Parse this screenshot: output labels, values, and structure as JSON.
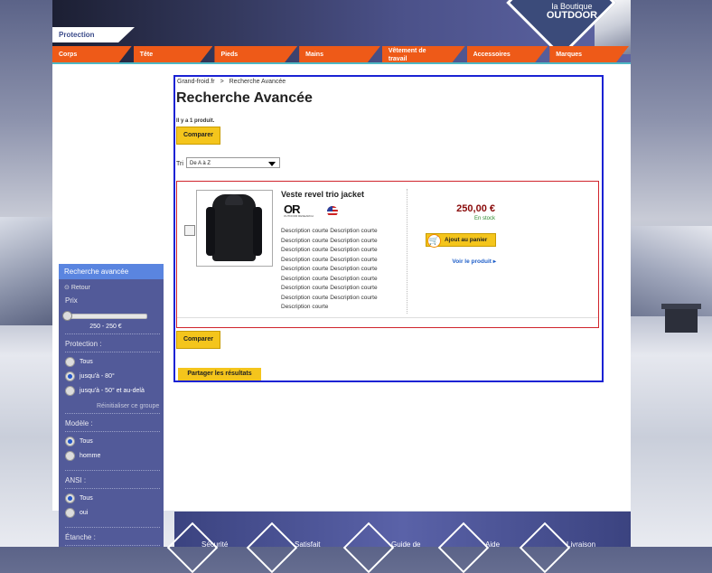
{
  "header": {
    "logo_line1": "la Boutique",
    "logo_line2": "OUTDOOR",
    "active_tab": "Protection",
    "nav": [
      "Corps",
      "Tête",
      "Pieds",
      "Mains",
      "Vêtement de travail",
      "Accessoires",
      "Marques"
    ]
  },
  "sidebar": {
    "title": "Recherche avancée",
    "back": "Retour",
    "prix_label": "Prix",
    "prix_range": "250 - 250 €",
    "prix_slider_value": 0,
    "protection_label": "Protection :",
    "protection_options": [
      "Tous",
      "jusqu'à - 80°",
      "jusqu'à - 50° et au-delà"
    ],
    "protection_selected": 1,
    "reset": "Réinitialiser ce groupe",
    "modele_label": "Modèle :",
    "modele_options": [
      "Tous",
      "homme"
    ],
    "ansi_label": "ANSI :",
    "ansi_options": [
      "Tous",
      "oui"
    ],
    "etanche_label": "Étanche :"
  },
  "main": {
    "breadcrumb_home": "Grand-froid.fr",
    "breadcrumb_sep": ">",
    "breadcrumb_current": "Recherche Avancée",
    "title": "Recherche Avancée",
    "count": "Il y a 1 produit.",
    "compare_label": "Comparer",
    "sort_label": "Tri",
    "sort_value": "De A à Z",
    "share_label": "Partager les résultats"
  },
  "product": {
    "name": "Veste revel trio jacket",
    "brand_logo": "OR",
    "brand_sub": "OUTDOOR RESEARCH",
    "description": "Description courte  Description courte Description courte  Description courte Description courte  Description courte Description courte  Description courte Description courte  Description courte Description courte  Description courte Description courte  Description courte Description courte  Description courte Description courte",
    "price": "250,00 €",
    "stock": "En stock",
    "add_to_cart": "Ajout au panier",
    "view": "Voir le produit"
  },
  "footer": {
    "items": [
      "Sécurité",
      "Satisfait",
      "Guide de",
      "Aide",
      "Livraison"
    ]
  }
}
